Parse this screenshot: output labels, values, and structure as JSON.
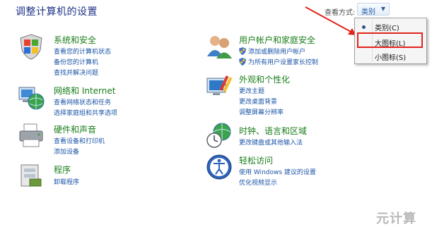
{
  "header": {
    "title": "调整计算机的设置",
    "view_by_label": "查看方式:",
    "view_by_value": "类别"
  },
  "view_menu": {
    "items": [
      {
        "label": "类别(C)",
        "selected": true
      },
      {
        "label": "大图标(L)",
        "selected": false,
        "highlighted": true
      },
      {
        "label": "小图标(S)",
        "selected": false
      }
    ]
  },
  "categories": [
    {
      "title": "系统和安全",
      "icon": "shield-flag-icon",
      "links": [
        "查看您的计算机状态",
        "备份您的计算机",
        "查找并解决问题"
      ]
    },
    {
      "title": "网络和 Internet",
      "icon": "network-globe-icon",
      "links": [
        "查看网络状态和任务",
        "选择家庭组和共享选项"
      ]
    },
    {
      "title": "硬件和声音",
      "icon": "printer-icon",
      "links": [
        "查看设备和打印机",
        "添加设备"
      ]
    },
    {
      "title": "程序",
      "icon": "programs-icon",
      "links": [
        "卸载程序"
      ]
    },
    {
      "title": "用户帐户和家庭安全",
      "icon": "users-icon",
      "links": [
        "添加或删除用户帐户",
        "为所有用户设置家长控制"
      ]
    },
    {
      "title": "外观和个性化",
      "icon": "appearance-icon",
      "links": [
        "更改主题",
        "更改桌面背景",
        "调整屏幕分辨率"
      ]
    },
    {
      "title": "时钟、语言和区域",
      "icon": "clock-globe-icon",
      "links": [
        "更改键盘或其他输入法"
      ]
    },
    {
      "title": "轻松访问",
      "icon": "ease-of-access-icon",
      "links": [
        "使用 Windows 建议的设置",
        "优化视频显示"
      ]
    }
  ],
  "watermark": "元计算",
  "colors": {
    "title": "#1e3287",
    "category": "#1a7d1a",
    "link": "#1b55a8",
    "highlight": "#e2231a"
  }
}
